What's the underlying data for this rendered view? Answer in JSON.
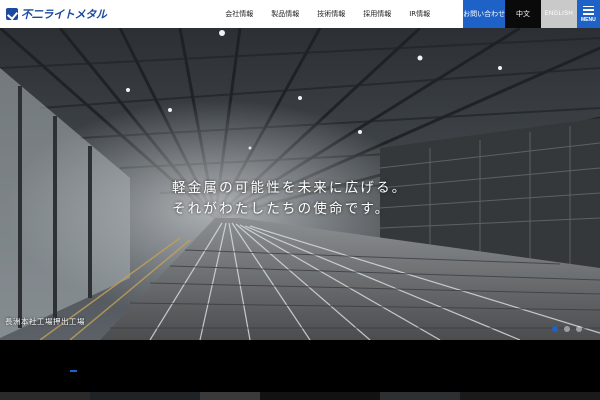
{
  "header": {
    "logo_text": "不二ライトメタル",
    "nav": [
      "会社情報",
      "製品情報",
      "技術情報",
      "採用情報",
      "IR情報"
    ],
    "contact_label": "お問い合わせ",
    "chinese_label": "中文",
    "english_label": "ENGLISH",
    "menu_label": "MENU"
  },
  "hero": {
    "headline_line1": "軽金属の可能性を未来に広げる。",
    "headline_line2": "それがわたしたちの使命です。",
    "caption": "長洲本社工場押出工場",
    "slide_count": 3,
    "active_slide": 1
  },
  "colors": {
    "brand_blue": "#1b4aa0",
    "accent_blue": "#1e62c8",
    "dark": "#0a0a0a",
    "grey_button": "#c9c9c9"
  }
}
